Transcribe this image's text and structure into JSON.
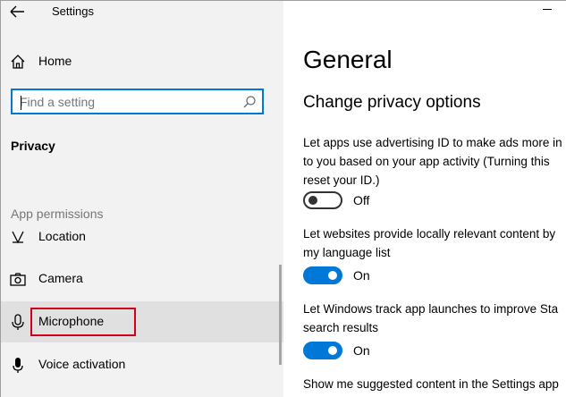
{
  "window": {
    "title": "Settings"
  },
  "sidebar": {
    "home_label": "Home",
    "search": {
      "placeholder": "Find a setting",
      "value": ""
    },
    "section_title": "Privacy",
    "group_header": "App permissions",
    "items": [
      {
        "label": "Location",
        "icon": "location-icon"
      },
      {
        "label": "Camera",
        "icon": "camera-icon"
      },
      {
        "label": "Microphone",
        "icon": "microphone-icon",
        "selected": true,
        "highlighted": true
      },
      {
        "label": "Voice activation",
        "icon": "voice-activation-icon"
      }
    ]
  },
  "main": {
    "title": "General",
    "subtitle": "Change privacy options",
    "settings": [
      {
        "lines": [
          "Let apps use advertising ID to make ads more in",
          "to you based on your app activity (Turning this",
          "reset your ID.)"
        ],
        "state": "Off",
        "on": false
      },
      {
        "lines": [
          "Let websites provide locally relevant content by",
          "my language list"
        ],
        "state": "On",
        "on": true
      },
      {
        "lines": [
          "Let Windows track app launches to improve Sta",
          "search results"
        ],
        "state": "On",
        "on": true
      },
      {
        "lines": [
          "Show me suggested content in the Settings app"
        ]
      }
    ]
  },
  "colors": {
    "accent": "#0078d7",
    "sidebar_bg": "#f2f2f2",
    "selected_row_bg": "#e0e0e0",
    "highlight_border": "#d0021b"
  }
}
